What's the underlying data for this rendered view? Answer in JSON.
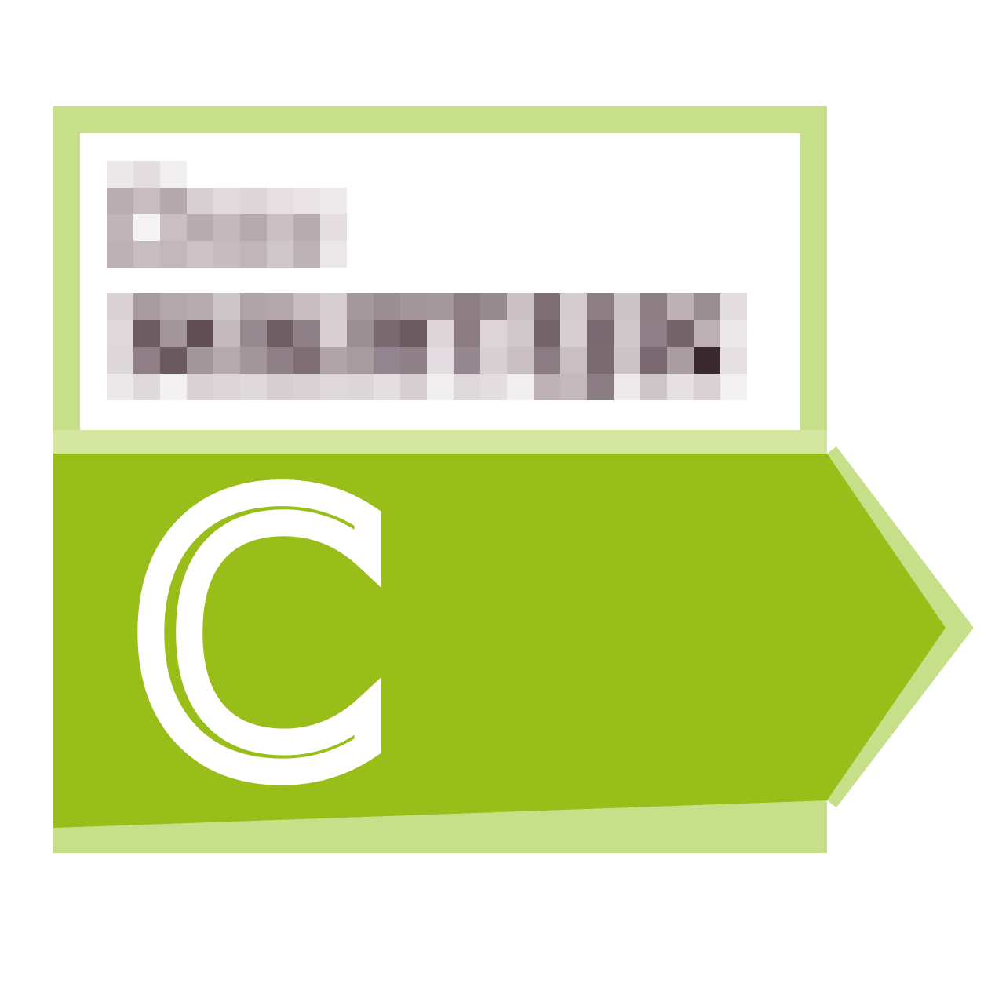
{
  "badge": {
    "small_word": "Der",
    "big_word": "NATUR",
    "grade": "C"
  },
  "colors": {
    "frame_light_green": "#c8df8a",
    "fill_green": "#99be1a",
    "text_grey_dark": "#6e5a60",
    "text_grey_light": "#c3b8bc",
    "background": "#ffffff"
  }
}
